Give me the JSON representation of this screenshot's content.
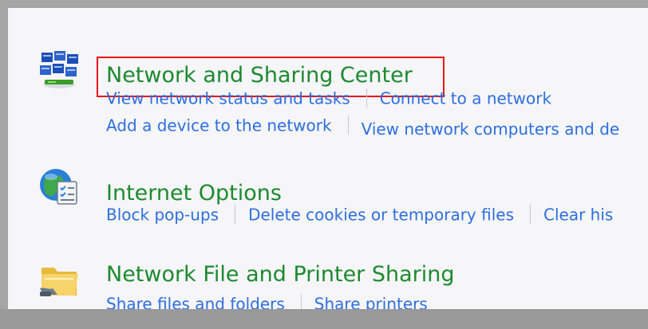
{
  "categories": [
    {
      "title": "Network and Sharing Center",
      "icon": "network-sharing-icon",
      "links_row1": [
        "View network status and tasks",
        "Connect to a network"
      ],
      "links_row2": [
        "Add a device to the network",
        "View network computers and de"
      ]
    },
    {
      "title": "Internet Options",
      "icon": "internet-options-icon",
      "links_row1": [
        "Block pop-ups",
        "Delete cookies or temporary files",
        "Clear his"
      ]
    },
    {
      "title": "Network File and Printer Sharing",
      "icon": "folder-sharing-icon",
      "links_row1": [
        "Share files and folders",
        "Share printers"
      ]
    }
  ],
  "colors": {
    "title_green": "#1c8a2f",
    "link_blue": "#2d6ee0",
    "highlight_red": "#e8121b",
    "panel_bg": "#f6f6f9"
  }
}
